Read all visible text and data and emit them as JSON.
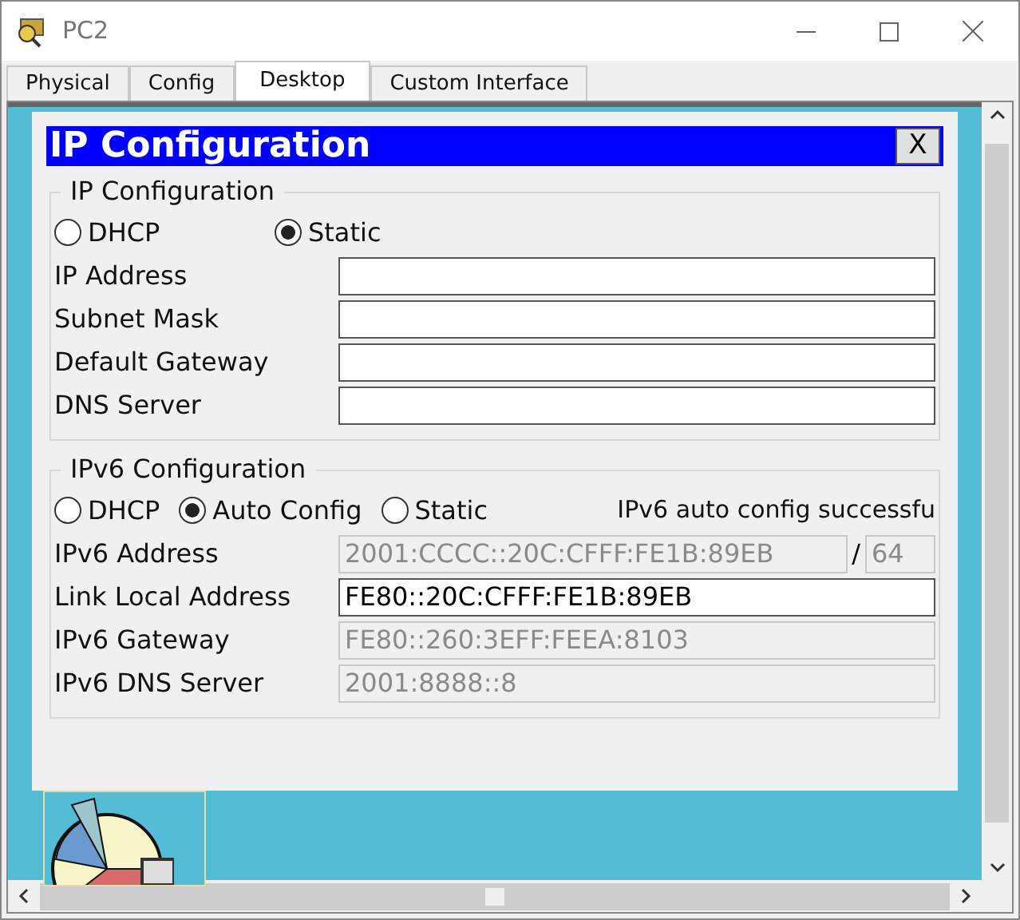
{
  "window": {
    "title": "PC2"
  },
  "tabs": [
    {
      "label": "Physical",
      "selected": false
    },
    {
      "label": "Config",
      "selected": false
    },
    {
      "label": "Desktop",
      "selected": true
    },
    {
      "label": "Custom Interface",
      "selected": false
    }
  ],
  "dialog": {
    "title": "IP Configuration",
    "close": "X",
    "ipv4": {
      "legend": "IP Configuration",
      "modes": [
        {
          "label": "DHCP",
          "selected": false
        },
        {
          "label": "Static",
          "selected": true
        }
      ],
      "fields": [
        {
          "label": "IP Address",
          "disabled": false
        },
        {
          "label": "Subnet Mask",
          "disabled": false
        },
        {
          "label": "Default Gateway",
          "disabled": false
        },
        {
          "label": "DNS Server",
          "disabled": false
        }
      ]
    },
    "ipv6": {
      "legend": "IPv6 Configuration",
      "modes": [
        {
          "label": "DHCP",
          "selected": false
        },
        {
          "label": "Auto Config",
          "selected": true
        },
        {
          "label": "Static",
          "selected": false
        }
      ],
      "status": "IPv6 auto config successfu",
      "fields": [
        {
          "label": "IPv6 Address",
          "value": "2001:CCCC::20C:CFFF:FE1B:89EB",
          "disabled": true,
          "separator": "/",
          "prefix": "64"
        },
        {
          "label": "Link Local Address",
          "value": "FE80::20C:CFFF:FE1B:89EB",
          "disabled": false
        },
        {
          "label": "IPv6 Gateway",
          "value": "FE80::260:3EFF:FEEA:8103",
          "disabled": true
        },
        {
          "label": "IPv6 DNS Server",
          "value": "2001:8888::8",
          "disabled": true
        }
      ]
    }
  }
}
